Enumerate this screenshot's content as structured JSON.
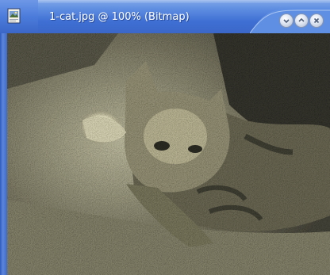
{
  "window": {
    "title": "1-cat.jpg @ 100% (Bitmap)",
    "doc_icon": "photoshop-document-icon",
    "controls": [
      {
        "name": "minimize-button",
        "icon": "minimize-icon"
      },
      {
        "name": "maximize-button",
        "icon": "maximize-icon"
      },
      {
        "name": "close-button",
        "icon": "close-icon"
      }
    ],
    "accent_color": "#3f6fd3"
  },
  "canvas": {
    "content": "photo-cat"
  }
}
